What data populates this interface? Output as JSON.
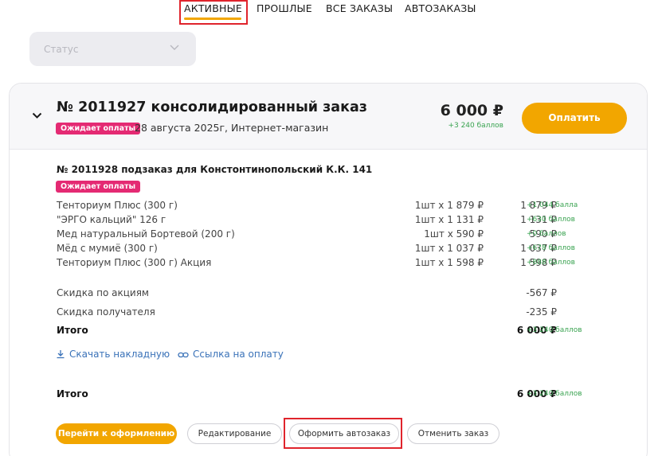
{
  "tabs": [
    {
      "label": "АКТИВНЫЕ"
    },
    {
      "label": "ПРОШЛЫЕ"
    },
    {
      "label": "ВСЕ ЗАКАЗЫ"
    },
    {
      "label": "АВТОЗАКАЗЫ"
    }
  ],
  "filter": {
    "status_placeholder": "Статус"
  },
  "order": {
    "title": "№ 2011927 консолидированный заказ",
    "status_badge": "Ожидает оплаты",
    "date_info": "28 августа 2025г, Интернет-магазин",
    "total": "6 000 ₽",
    "bonus": "+3 240 баллов",
    "pay_label": "Оплатить",
    "suborder": {
      "title": "№ 2011928 подзаказ для Констонтинопольский К.К. 141",
      "status_badge": "Ожидает оплаты",
      "items": [
        {
          "name": "Тенториум Плюс (300 г)",
          "qty": "1шт x 1 879 ₽",
          "sum": "1 879 ₽",
          "points": "+1 044 балла"
        },
        {
          "name": "\"ЭРГО кальций\" 126 г",
          "qty": "1шт x 1 131 ₽",
          "sum": "1 131 ₽",
          "points": "+630 баллов"
        },
        {
          "name": "Мед натуральный Бортевой (200 г)",
          "qty": "1шт x 590 ₽",
          "sum": "590 ₽",
          "points": "+0 баллов"
        },
        {
          "name": "Мёд с мумиё (300 г)",
          "qty": "1шт x 1 037 ₽",
          "sum": "1 037 ₽",
          "points": "+678 баллов"
        },
        {
          "name": "Тенториум Плюс (300 г) Акция",
          "qty": "1шт x 1 598 ₽",
          "sum": "1 598 ₽",
          "points": "+888 баллов"
        }
      ],
      "discount_promo": {
        "label": "Скидка по акциям",
        "value": "-567 ₽"
      },
      "discount_recipient": {
        "label": "Скидка получателя",
        "value": "-235 ₽"
      },
      "total": {
        "label": "Итого",
        "value": "6 000 ₽",
        "points": "+3 240 баллов"
      },
      "download_invoice": "Скачать накладную",
      "payment_link": "Ссылка на оплату"
    },
    "grand_total": {
      "label": "Итого",
      "value": "6 000 ₽",
      "points": "+3 240 баллов"
    },
    "actions": {
      "checkout": "Перейти к оформлению",
      "edit": "Редактирование",
      "autoorder": "Оформить автозаказ",
      "cancel": "Отменить заказ"
    }
  },
  "colors": {
    "accent": "#f2a600",
    "badge": "#e42a73",
    "bonus": "#3aa351",
    "link": "#3a72b8",
    "highlight": "#e0242c"
  },
  "icons": [
    "chevron-down-icon",
    "download-icon",
    "link-icon"
  ]
}
